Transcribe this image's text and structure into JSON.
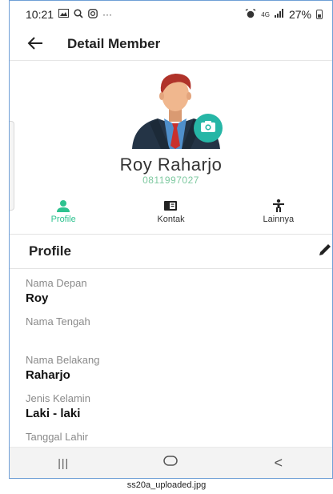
{
  "status_bar": {
    "time": "10:21",
    "left_icons": [
      "image-icon",
      "search-icon",
      "instagram-icon"
    ],
    "more": "···",
    "network": "4G",
    "battery": "27%"
  },
  "app_bar": {
    "back_icon": "arrow-left-icon",
    "title": "Detail Member"
  },
  "profile": {
    "name": "Roy Raharjo",
    "phone": "0811997027",
    "camera_icon": "camera-icon"
  },
  "tabs": [
    {
      "label": "Profile",
      "icon": "person-icon",
      "active": true
    },
    {
      "label": "Kontak",
      "icon": "contact-book-icon",
      "active": false
    },
    {
      "label": "Lainnya",
      "icon": "accessibility-icon",
      "active": false
    }
  ],
  "section": {
    "title": "Profile",
    "edit_icon": "pencil-icon"
  },
  "fields": [
    {
      "label": "Nama Depan",
      "value": "Roy"
    },
    {
      "label": "Nama Tengah",
      "value": ""
    },
    {
      "label": "Nama Belakang",
      "value": "Raharjo"
    },
    {
      "label": "Jenis Kelamin",
      "value": "Laki - laki"
    },
    {
      "label": "Tanggal Lahir",
      "value": ""
    }
  ],
  "nav_bar": {
    "recents": "|||",
    "home": "home-icon",
    "back": "<"
  },
  "caption": "ss20a_uploaded.jpg",
  "colors": {
    "accent": "#2ec28f",
    "camera_button": "#26b6a6",
    "phone_text": "#7ec9a0"
  }
}
